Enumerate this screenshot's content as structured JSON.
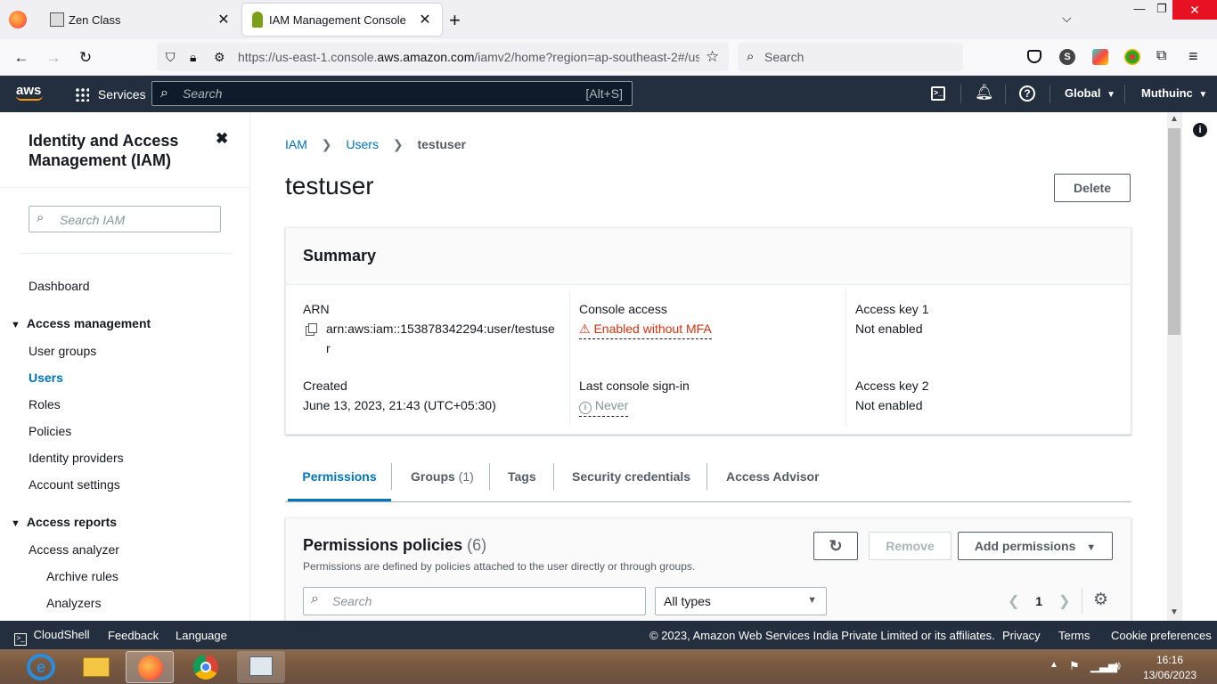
{
  "browser": {
    "tabs": [
      {
        "title": "Zen Class",
        "active": false
      },
      {
        "title": "IAM Management Console",
        "active": true
      }
    ],
    "url": "https://us-east-1.console.aws.amazon.com/iamv2/home?region=ap-southeast-2#/us",
    "url_prefix": "https://us-east-1.console.",
    "url_domain": "aws.amazon.com",
    "url_suffix": "/iamv2/home?region=ap-southeast-2#/us",
    "search_placeholder": "Search"
  },
  "aws_nav": {
    "logo": "aws",
    "services_label": "Services",
    "search_placeholder": "Search",
    "search_shortcut": "[Alt+S]",
    "region": "Global",
    "account": "Muthuinc"
  },
  "sidebar": {
    "title": "Identity and Access Management (IAM)",
    "search_placeholder": "Search IAM",
    "dashboard": "Dashboard",
    "sections": [
      {
        "label": "Access management",
        "items": [
          "User groups",
          "Users",
          "Roles",
          "Policies",
          "Identity providers",
          "Account settings"
        ]
      },
      {
        "label": "Access reports",
        "items": [
          "Access analyzer",
          "Archive rules",
          "Analyzers"
        ]
      }
    ],
    "active_item": "Users"
  },
  "breadcrumb": {
    "items": [
      "IAM",
      "Users",
      "testuser"
    ]
  },
  "page": {
    "title": "testuser",
    "delete_label": "Delete"
  },
  "summary": {
    "heading": "Summary",
    "arn_label": "ARN",
    "arn_line1": "arn:aws:iam::153878342294:user/testuse",
    "arn_line2": "r",
    "created_label": "Created",
    "created_value": "June 13, 2023, 21:43 (UTC+05:30)",
    "console_access_label": "Console access",
    "console_access_value": "Enabled without MFA",
    "last_signin_label": "Last console sign-in",
    "last_signin_value": "Never",
    "access_key1_label": "Access key 1",
    "access_key1_value": "Not enabled",
    "access_key2_label": "Access key 2",
    "access_key2_value": "Not enabled"
  },
  "tabs": [
    {
      "label": "Permissions",
      "count": ""
    },
    {
      "label": "Groups",
      "count": "(1)"
    },
    {
      "label": "Tags",
      "count": ""
    },
    {
      "label": "Security credentials",
      "count": ""
    },
    {
      "label": "Access Advisor",
      "count": ""
    }
  ],
  "permissions": {
    "heading": "Permissions policies",
    "count": "(6)",
    "description": "Permissions are defined by policies attached to the user directly or through groups.",
    "remove_label": "Remove",
    "add_label": "Add permissions",
    "search_placeholder": "Search",
    "filter_value": "All types",
    "page_number": "1"
  },
  "footer": {
    "cloudshell": "CloudShell",
    "feedback": "Feedback",
    "language": "Language",
    "copyright": "© 2023, Amazon Web Services India Private Limited or its affiliates.",
    "privacy": "Privacy",
    "terms": "Terms",
    "cookie": "Cookie preferences"
  },
  "taskbar": {
    "time": "16:16",
    "date": "13/06/2023"
  },
  "colors": {
    "aws_nav": "#232f3e",
    "link": "#0073bb",
    "warning": "#d13212",
    "tab_active": "#0073bb"
  }
}
